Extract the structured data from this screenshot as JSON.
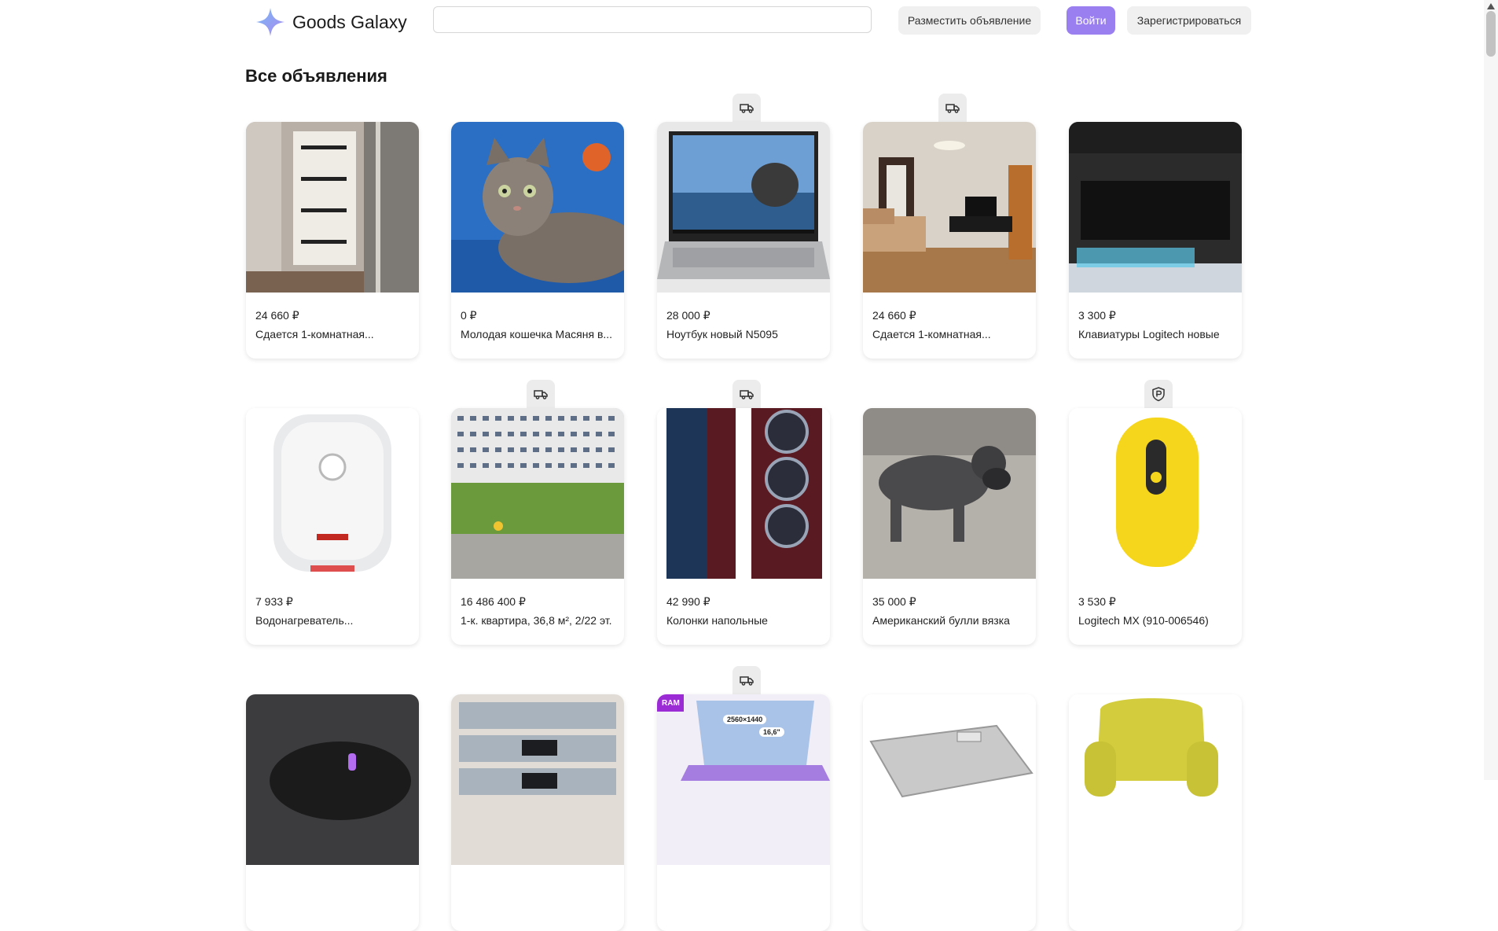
{
  "header": {
    "logo_text": "Goods Galaxy",
    "search_placeholder": "",
    "place_ad_label": "Разместить объявление",
    "login_label": "Войти",
    "register_label": "Зарегистрироваться"
  },
  "page": {
    "title": "Все объявления"
  },
  "accent_color": "#9a7ff0",
  "listings": [
    {
      "price": "24 660 ₽",
      "title": "Сдается 1-комнатная...",
      "image": "door-photo",
      "badge": ""
    },
    {
      "price": "0 ₽",
      "title": "Молодая кошечка Масяня в...",
      "image": "cat-photo",
      "badge": ""
    },
    {
      "price": "28 000 ₽",
      "title": "Ноутбук новый N5095",
      "image": "laptop-photo",
      "badge": "truck-icon"
    },
    {
      "price": "24 660 ₽",
      "title": "Сдается 1-комнатная...",
      "image": "living-room-photo",
      "badge": "truck-icon"
    },
    {
      "price": "3 300 ₽",
      "title": "Клавиатуры Logitech новые",
      "image": "keyboard-photo",
      "badge": ""
    },
    {
      "price": "7 933 ₽",
      "title": "Водонагреватель...",
      "image": "water-heater-photo",
      "badge": ""
    },
    {
      "price": "16 486 400 ₽",
      "title": "1-к. квартира, 36,8 м², 2/22 эт.",
      "image": "building-photo",
      "badge": "truck-icon"
    },
    {
      "price": "42 990 ₽",
      "title": "Колонки напольные",
      "image": "speakers-photo",
      "badge": "truck-icon"
    },
    {
      "price": "35 000 ₽",
      "title": "Американский булли вязка",
      "image": "dog-photo",
      "badge": ""
    },
    {
      "price": "3 530 ₽",
      "title": "Logitech MX (910-006546)",
      "image": "mouse-photo",
      "badge": "ruble-shield-icon"
    },
    {
      "price": "",
      "title": "",
      "image": "gaming-mouse-photo",
      "badge": ""
    },
    {
      "price": "",
      "title": "",
      "image": "audio-receivers-photo",
      "badge": ""
    },
    {
      "price": "",
      "title": "",
      "image": "purple-laptop-photo",
      "badge": "truck-icon",
      "image_labels": [
        "RAM",
        "2560×1440",
        "16,6\""
      ]
    },
    {
      "price": "",
      "title": "",
      "image": "grease-filter-photo",
      "badge": ""
    },
    {
      "price": "",
      "title": "",
      "image": "yellow-armchair-photo",
      "badge": ""
    }
  ]
}
